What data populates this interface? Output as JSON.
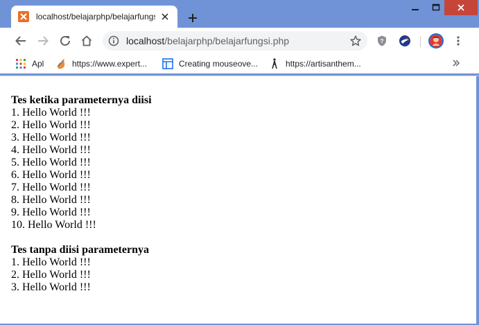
{
  "window": {
    "minimize_icon": "minimize-icon",
    "maximize_icon": "maximize-icon",
    "close_icon": "close-icon"
  },
  "tab": {
    "title": "localhost/belajarphp/belajarfungs",
    "favicon": "xampp-icon"
  },
  "toolbar": {
    "url_host": "localhost",
    "url_path": "/belajarphp/belajarfungsi.php"
  },
  "bookmarks": [
    {
      "label": "Apl",
      "icon": "apps-grid-icon"
    },
    {
      "label": "https://www.expert...",
      "icon": "flame-icon"
    },
    {
      "label": "Creating mouseove...",
      "icon": "page-layout-icon"
    },
    {
      "label": "https://artisanthem...",
      "icon": "person-walking-icon"
    }
  ],
  "page": {
    "heading1": "Tes ketika parameternya diisi",
    "list1": [
      "1. Hello World !!!",
      "2. Hello World !!!",
      "3. Hello World !!!",
      "4. Hello World !!!",
      "5. Hello World !!!",
      "6. Hello World !!!",
      "7. Hello World !!!",
      "8. Hello World !!!",
      "9. Hello World !!!",
      "10. Hello World !!!"
    ],
    "heading2": "Tes tanpa diisi parameternya",
    "list2": [
      "1. Hello World !!!",
      "2. Hello World !!!",
      "3. Hello World !!!"
    ]
  }
}
